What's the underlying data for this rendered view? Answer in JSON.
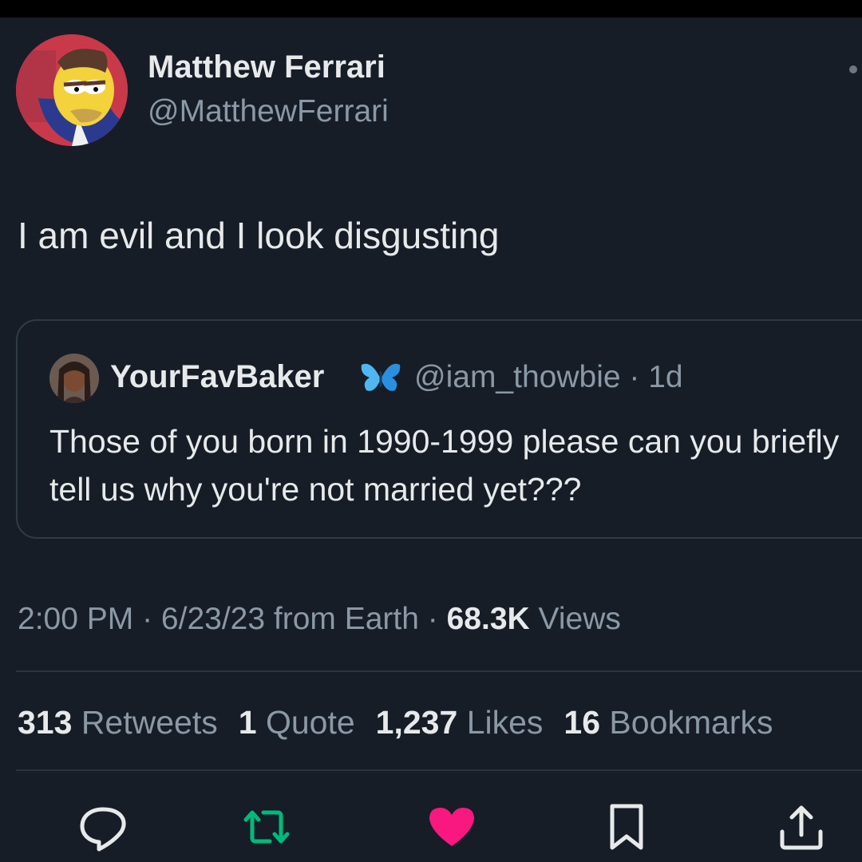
{
  "tweet": {
    "author_name": "Matthew Ferrari",
    "author_handle": "@MatthewFerrari",
    "text": "I am evil and I look disgusting",
    "avatar_icon": "cartoon-avatar-icon"
  },
  "quoted_tweet": {
    "author_name": "YourFavBaker",
    "verified_icon": "blue-butterfly-icon",
    "handle_time": "@iam_thowbie · 1d",
    "text": "Those of you born in 1990-1999 please can you briefly tell us why you're not married yet???"
  },
  "meta": {
    "time": "2:00 PM",
    "separator": " · ",
    "date_source": "6/23/23 from Earth",
    "views_count": "68.3K",
    "views_label": "Views"
  },
  "stats": {
    "retweets_count": "313",
    "retweets_label": "Retweets",
    "quotes_count": "1",
    "quotes_label": "Quote",
    "likes_count": "1,237",
    "likes_label": "Likes",
    "bookmarks_count": "16",
    "bookmarks_label": "Bookmarks"
  },
  "actions": [
    {
      "icon": "reply-icon"
    },
    {
      "icon": "retweet-icon"
    },
    {
      "icon": "like-heart-icon"
    },
    {
      "icon": "bookmark-icon"
    },
    {
      "icon": "share-icon"
    }
  ],
  "colors": {
    "background": "#161d27",
    "text_primary": "#e7e9ea",
    "text_secondary": "#8b98a5",
    "retweet_green": "#00ba7c",
    "like_pink": "#f91880",
    "verified_blue": "#1d9bf0"
  }
}
